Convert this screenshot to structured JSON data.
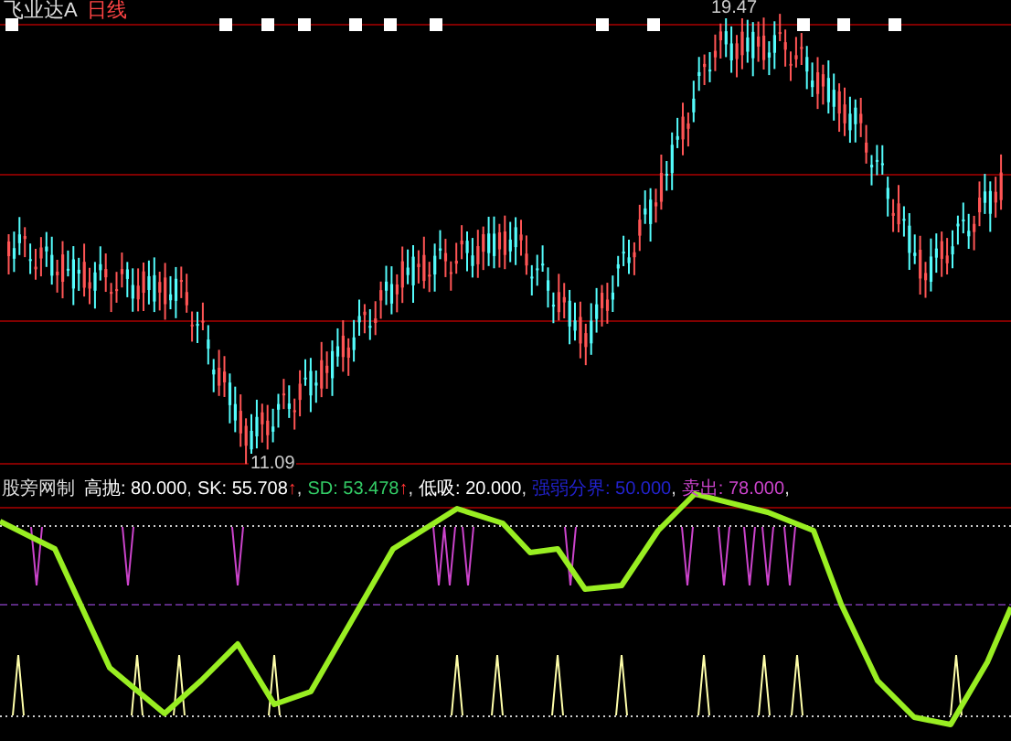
{
  "title": {
    "name": "飞业达A",
    "period": "日线"
  },
  "price_labels": [
    {
      "kind": "high",
      "text": "19.47"
    },
    {
      "kind": "low",
      "text": "11.09"
    }
  ],
  "indicator": {
    "name": "股旁网制",
    "values": [
      {
        "text": "高抛: 80.000",
        "end": ",",
        "color": "#ffffff"
      },
      {
        "text": "SK: 55.708",
        "arrow": "↑",
        "end": ",",
        "color": "#ffffff"
      },
      {
        "text": "SD: 53.478",
        "arrow": "↑",
        "end": ",",
        "color": "#33cc66"
      },
      {
        "text": "低吸: 20.000",
        "end": ",",
        "color": "#ffffff"
      },
      {
        "text": "强弱分界: 50.000",
        "end": ",",
        "color": "#2222cc"
      },
      {
        "text": "卖出: 78.000",
        "end": ",",
        "color": "#cc44cc"
      }
    ]
  }
}
